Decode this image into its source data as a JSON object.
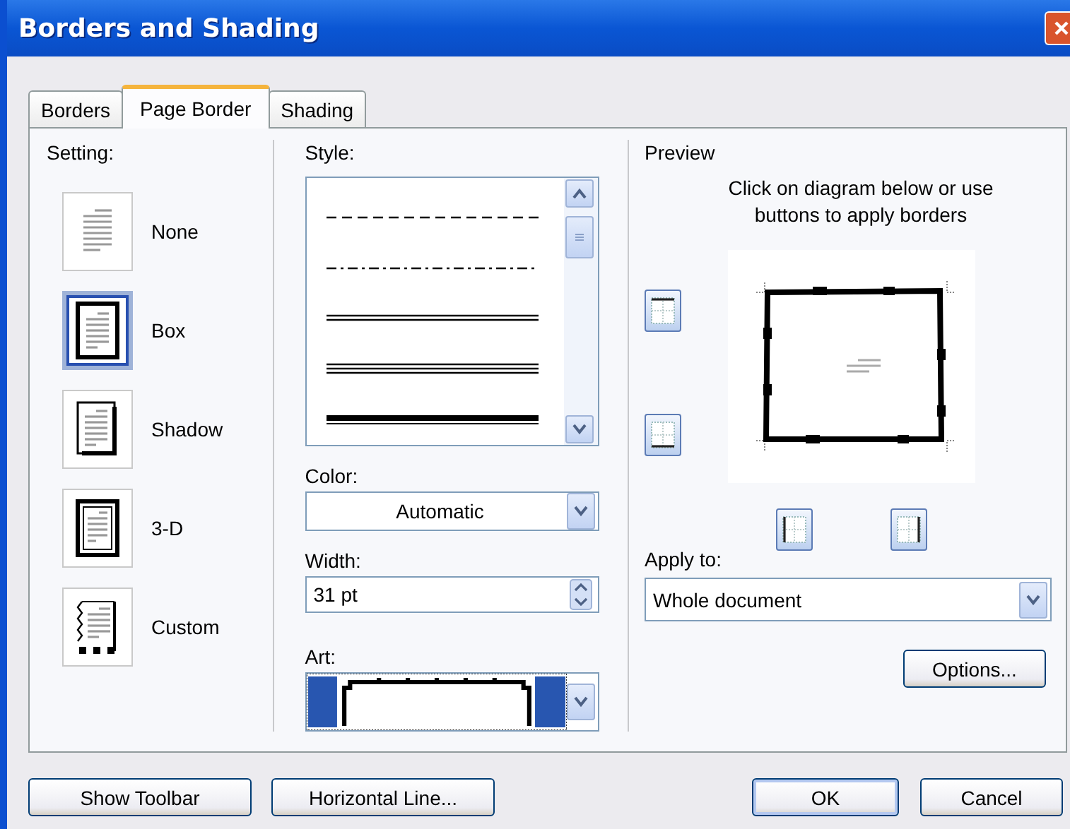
{
  "window": {
    "title": "Borders and Shading"
  },
  "tabs": [
    {
      "label": "Borders",
      "selected": false
    },
    {
      "label": "Page Border",
      "selected": true
    },
    {
      "label": "Shading",
      "selected": false
    }
  ],
  "setting": {
    "label": "Setting:",
    "options": [
      {
        "label": "None",
        "kind": "none",
        "selected": false
      },
      {
        "label": "Box",
        "kind": "box",
        "selected": true
      },
      {
        "label": "Shadow",
        "kind": "shadow",
        "selected": false
      },
      {
        "label": "3-D",
        "kind": "threed",
        "selected": false
      },
      {
        "label": "Custom",
        "kind": "custom",
        "selected": false
      }
    ]
  },
  "style": {
    "label": "Style:",
    "lines": [
      {
        "kind": "dash",
        "selected": false
      },
      {
        "kind": "dashdot",
        "selected": false
      },
      {
        "kind": "double",
        "selected": false
      },
      {
        "kind": "triple",
        "selected": false
      },
      {
        "kind": "thickthin",
        "selected": false
      }
    ]
  },
  "color": {
    "label": "Color:",
    "value": "Automatic"
  },
  "width": {
    "label": "Width:",
    "value": "31 pt"
  },
  "art": {
    "label": "Art:"
  },
  "preview": {
    "label": "Preview",
    "hint": "Click on diagram below or use buttons to apply borders"
  },
  "apply_to": {
    "label": "Apply to:",
    "value": "Whole document"
  },
  "options_button": {
    "label": "Options..."
  },
  "buttons": [
    {
      "label": "Show Toolbar",
      "kind": "normal"
    },
    {
      "label": "Horizontal Line...",
      "kind": "normal"
    },
    {
      "label": "OK",
      "kind": "default"
    },
    {
      "label": "Cancel",
      "kind": "normal"
    }
  ]
}
